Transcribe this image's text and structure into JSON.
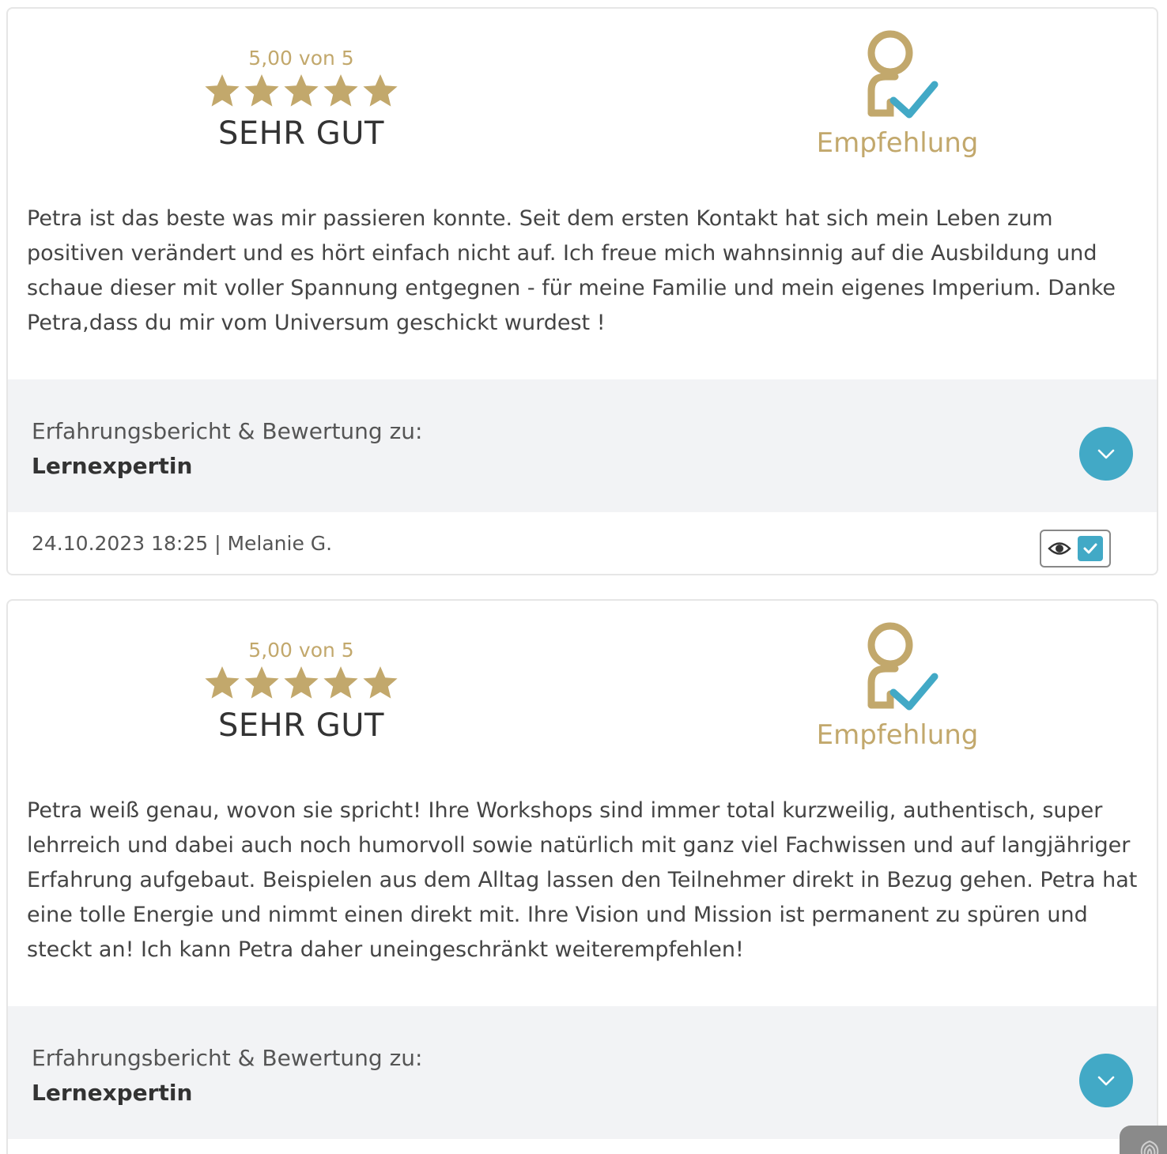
{
  "reviews": [
    {
      "score_text": "5,00 von 5",
      "stars": 5,
      "verdict": "SEHR GUT",
      "recommendation_label": "Empfehlung",
      "recommendation_icon": "user-check-icon",
      "text": "Petra ist das beste was mir passieren konnte. Seit dem ersten Kontakt hat sich mein Leben zum positiven verändert und es hört einfach nicht auf. Ich freue mich wahnsinnig auf die Ausbildung und schaue dieser mit voller Spannung entgegnen - für meine Familie und mein eigenes Imperium. Danke Petra,dass du mir vom Universum geschickt wurdest !",
      "about_label": "Erfahrungsbericht & Bewertung zu:",
      "about_product": "Lernexpertin",
      "meta": "24.10.2023 18:25 | Melanie G."
    },
    {
      "score_text": "5,00 von 5",
      "stars": 5,
      "verdict": "SEHR GUT",
      "recommendation_label": "Empfehlung",
      "recommendation_icon": "user-check-icon",
      "text": "Petra weiß genau, wovon sie spricht! Ihre Workshops sind immer total kurzweilig, authentisch, super lehrreich und dabei auch noch humorvoll sowie natürlich mit ganz viel Fachwissen und auf langjähriger Erfahrung aufgebaut. Beispielen aus dem Alltag lassen den Teilnehmer direkt in Bezug gehen. Petra hat eine tolle Energie und nimmt einen direkt mit. Ihre Vision und Mission ist permanent zu spüren und steckt an! Ich kann Petra daher uneingeschränkt weiterempfehlen!",
      "about_label": "Erfahrungsbericht & Bewertung zu:",
      "about_product": "Lernexpertin"
    }
  ],
  "colors": {
    "gold": "#c2a86c",
    "accent_blue": "#42a9c6",
    "bar_gray": "#f2f3f5",
    "text": "#333333"
  }
}
